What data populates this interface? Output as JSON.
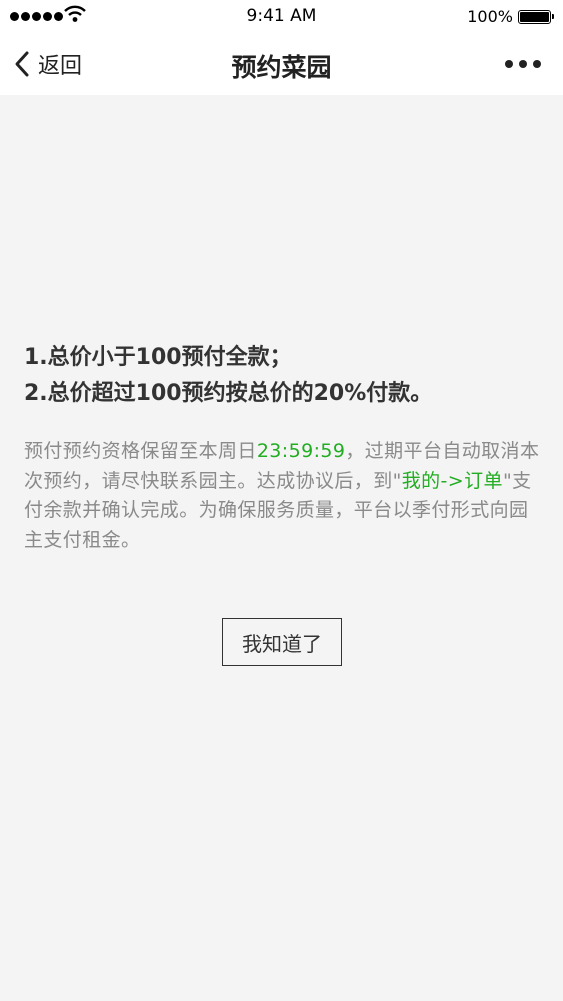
{
  "status_bar": {
    "time": "9:41 AM",
    "battery": "100%",
    "icons": [
      "signal-dots-icon",
      "wifi-icon",
      "battery-icon"
    ]
  },
  "nav": {
    "back_label": "返回",
    "title": "预约菜园",
    "icons": [
      "chevron-left-icon",
      "more-icon"
    ]
  },
  "rules": [
    "1.总价小于100预付全款；",
    "2.总价超过100预约按总价的20%付款。"
  ],
  "notice": {
    "part1": "预付预约资格保留至本周日",
    "deadline": "23:59:59",
    "part2": "，过期平台自动取消本次预约，请尽快联系园主。达成协议后，到\"",
    "link": "我的->订单",
    "part3": "\"支付余款并确认完成。为确保服务质量，平台以季付形式向园主支付租金。"
  },
  "button": {
    "label": "我知道了"
  },
  "colors": {
    "accent_green": "#22ad22",
    "background": "#f4f4f4",
    "bar": "#ffffff",
    "muted_text": "#8a8a8a"
  }
}
